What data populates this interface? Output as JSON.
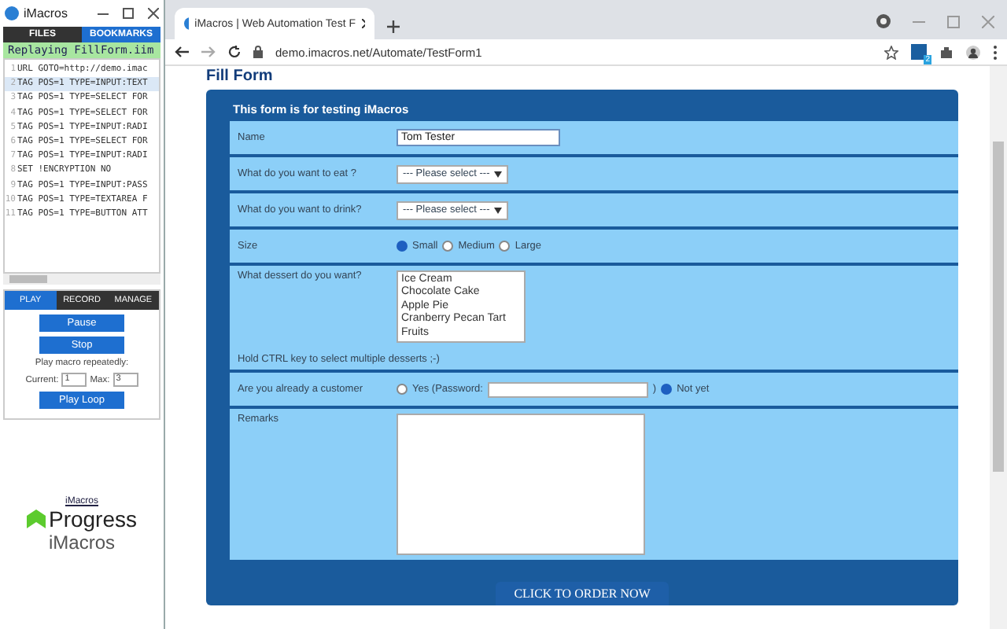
{
  "imacros": {
    "title": "iMacros",
    "tabs": [
      {
        "label": "FILES",
        "selected": false
      },
      {
        "label": "BOOKMARKS",
        "selected": true
      }
    ],
    "status": "Replaying FillForm.iim",
    "lines": [
      {
        "number": "1",
        "code": "URL GOTO=http://demo.imac",
        "selected": false
      },
      {
        "number": "2",
        "code": "TAG POS=1 TYPE=INPUT:TEXT",
        "selected": true
      },
      {
        "number": "3",
        "code": "TAG POS=1 TYPE=SELECT FOR",
        "selected": false
      },
      {
        "number": "4",
        "code": "TAG POS=1 TYPE=SELECT FOR",
        "selected": false
      },
      {
        "number": "5",
        "code": "TAG POS=1 TYPE=INPUT:RADI",
        "selected": false
      },
      {
        "number": "6",
        "code": "TAG POS=1 TYPE=SELECT FOR",
        "selected": false
      },
      {
        "number": "7",
        "code": "TAG POS=1 TYPE=INPUT:RADI",
        "selected": false
      },
      {
        "number": "8",
        "code": "SET !ENCRYPTION NO",
        "selected": false
      },
      {
        "number": "9",
        "code": "TAG POS=1 TYPE=INPUT:PASS",
        "selected": false
      },
      {
        "number": "10",
        "code": "TAG POS=1 TYPE=TEXTAREA F",
        "selected": false
      },
      {
        "number": "11",
        "code": "TAG POS=1 TYPE=BUTTON ATT",
        "selected": false
      }
    ],
    "mode_tabs": [
      {
        "label": "PLAY",
        "selected": true
      },
      {
        "label": "RECORD",
        "selected": false
      },
      {
        "label": "MANAGE",
        "selected": false
      }
    ],
    "buttons": [
      "Pause",
      "Stop"
    ],
    "repeat_label": "Play macro repeatedly:",
    "current_label": "Current:",
    "current_value": "1",
    "max_label": "Max:",
    "max_value": "3",
    "loop_button": "Play Loop",
    "logo_link": "iMacros",
    "logo_brand": "Progress",
    "logo_product": "iMacros"
  },
  "browser": {
    "tab_title": "iMacros | Web Automation Test F",
    "url": "demo.imacros.net/Automate/TestForm1",
    "extension_badge": "2"
  },
  "page": {
    "heading": "Fill Form",
    "form_title": "This form is for testing iMacros",
    "name_label": "Name",
    "name_value": "Tom Tester",
    "eat_label": "What do you want to eat ?",
    "eat_select": "--- Please select ---",
    "drink_label": "What do you want to drink?",
    "drink_select": "--- Please select ---",
    "size_label": "Size",
    "sizes": [
      {
        "label": "Small",
        "selected": true
      },
      {
        "label": "Medium",
        "selected": false
      },
      {
        "label": "Large",
        "selected": false
      }
    ],
    "dessert_label": "What dessert do you want?",
    "desserts": [
      "Ice Cream",
      "Chocolate Cake",
      "Apple Pie",
      "Cranberry Pecan Tart",
      "Fruits"
    ],
    "dessert_hint": "Hold CTRL key to select multiple desserts ;-)",
    "customer_label": "Are you already a customer",
    "customer_options": [
      {
        "label": "Yes (Password:",
        "selected": false
      },
      {
        "label": "Not yet",
        "selected": true
      }
    ],
    "password_close": ")",
    "remarks_label": "Remarks",
    "submit": "CLICK TO ORDER NOW"
  }
}
